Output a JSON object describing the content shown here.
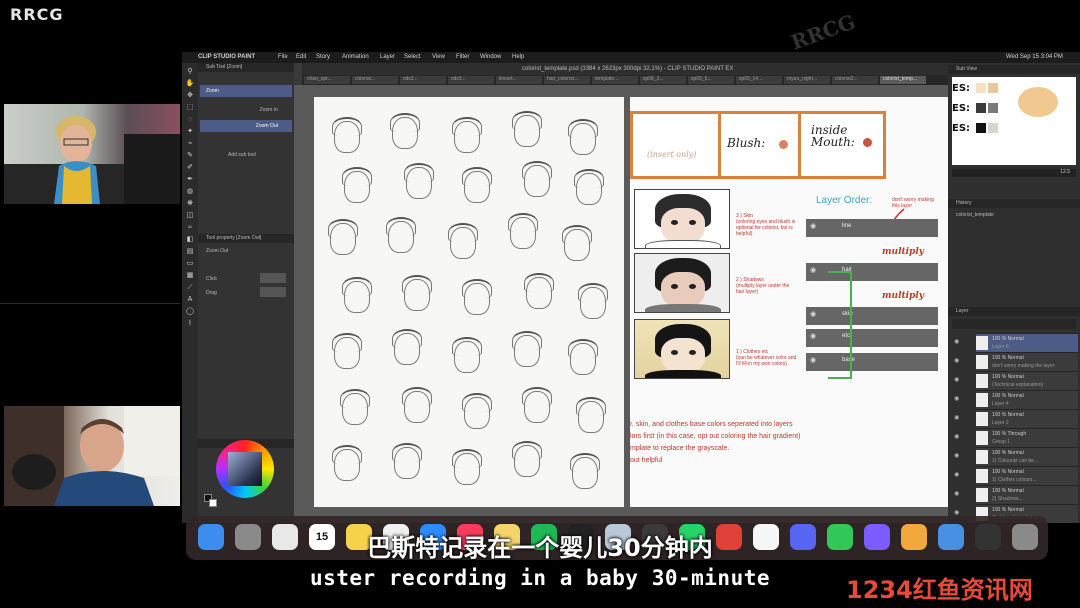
{
  "brand": "RRCG",
  "watermark": "RRCG",
  "corner_watermark": "1234红鱼资讯网",
  "subtitle_zh": "巴斯特记录在一个婴儿30分钟内",
  "subtitle_en": "uster recording in a baby 30-minute",
  "menubar": {
    "app": "CLIP STUDIO PAINT",
    "items": [
      "File",
      "Edit",
      "Story",
      "Animation",
      "Layer",
      "Select",
      "View",
      "Filter",
      "Window",
      "Help"
    ],
    "clock": "Wed Sep 15 3:04 PM"
  },
  "window_title": "colorist_template.psd (3384 x 2623px 300dpi 32.1%) - CLIP STUDIO PAINT EX",
  "tabs": [
    "chan_opt...",
    "colorist...",
    "cdx2...",
    "cdx3...",
    "lineart...",
    "hair_colorist...",
    "template...",
    "sp08_3...",
    "sp09_5...",
    "sp09_14...",
    "myuu_night...",
    "colorist2...",
    "colorist_temp..."
  ],
  "subtool": {
    "header": "Sub Tool [Zoom]",
    "items": [
      "Zoom",
      "Zoom In",
      "Zoom Out"
    ],
    "add_label": "Add sub tool"
  },
  "tool_property": {
    "header": "Tool property [Zoom Out]",
    "name": "Zoom Out",
    "rows": [
      "Click",
      "Drag"
    ]
  },
  "template": {
    "cell1_label": "(insert only)",
    "blush_label": "Blush:",
    "inside_mouth_label": "inside\nMouth:",
    "layer_order_title": "Layer Order:",
    "layer_order_note": "don't worry making this layer",
    "multiply_label": "multiply",
    "layers": [
      "line",
      "hair",
      "skin",
      "etc",
      "base"
    ],
    "notes": [
      "3 ) Skin\n(coloring eyes and blush is optional for colorist, but is helpful)",
      "2 ) Shadows\n(multiply layer under the hair layer)",
      "1 ) Clothes etc\n(can be whatever color and I'll fill in my own colors)"
    ],
    "footer_lines": [
      "r, skin, and clothes base colors seperated into layers",
      "lors first (in this case, opt out coloring the hair gradient)",
      "mplate to replace the grayscale.",
      "out helpful"
    ],
    "colors": {
      "border": "#d9813d",
      "blush_dot": "#d9825e",
      "mouth_dot": "#c8563d",
      "note_red": "#c0392b",
      "bracket_green": "#4caf50"
    }
  },
  "right_panel": {
    "sub_view_header": "Sub View",
    "history_header": "History",
    "history_item": "colorist_template",
    "layer_header": "Layer",
    "zoom_value": "12.5",
    "sub_view_labels": [
      "ES:",
      "ES:",
      "ES:"
    ],
    "sub_view_colors": [
      "#f2e3c6",
      "#e8c89a",
      "#3a3a3a",
      "#7a7a7a",
      "#111111",
      "#d8d4cc"
    ],
    "layers": [
      {
        "name": "100 % Normal",
        "sub": "Layer 6"
      },
      {
        "name": "100 % Normal",
        "sub": "don't worry making the layer"
      },
      {
        "name": "100 % Normal",
        "sub": "(Technical explanation)"
      },
      {
        "name": "100 % Normal",
        "sub": "Layer 4"
      },
      {
        "name": "100 % Normal",
        "sub": "Layer 2"
      },
      {
        "name": "100 % Through",
        "sub": "Group 1"
      },
      {
        "name": "100 % Normal",
        "sub": "1) Colourist can be..."
      },
      {
        "name": "100 % Normal",
        "sub": "1) Clothes colours..."
      },
      {
        "name": "100 % Normal",
        "sub": "2) Shadows..."
      },
      {
        "name": "100 % Normal",
        "sub": "3) skin colours being..."
      }
    ]
  },
  "dock_icons": [
    "finder-icon",
    "launchpad-icon",
    "chrome-icon",
    "calendar-icon",
    "notes-icon",
    "reminders-icon",
    "zoom-icon",
    "music-icon",
    "stickies-icon",
    "spotify-icon",
    "github-icon",
    "clip-studio-icon",
    "obs-icon",
    "whatsapp-icon",
    "video-icon",
    "photos-icon",
    "discord-icon",
    "messages-icon",
    "messenger-icon",
    "settings-icon",
    "folder-icon",
    "window-icon",
    "trash-icon"
  ],
  "calendar_day": "15"
}
